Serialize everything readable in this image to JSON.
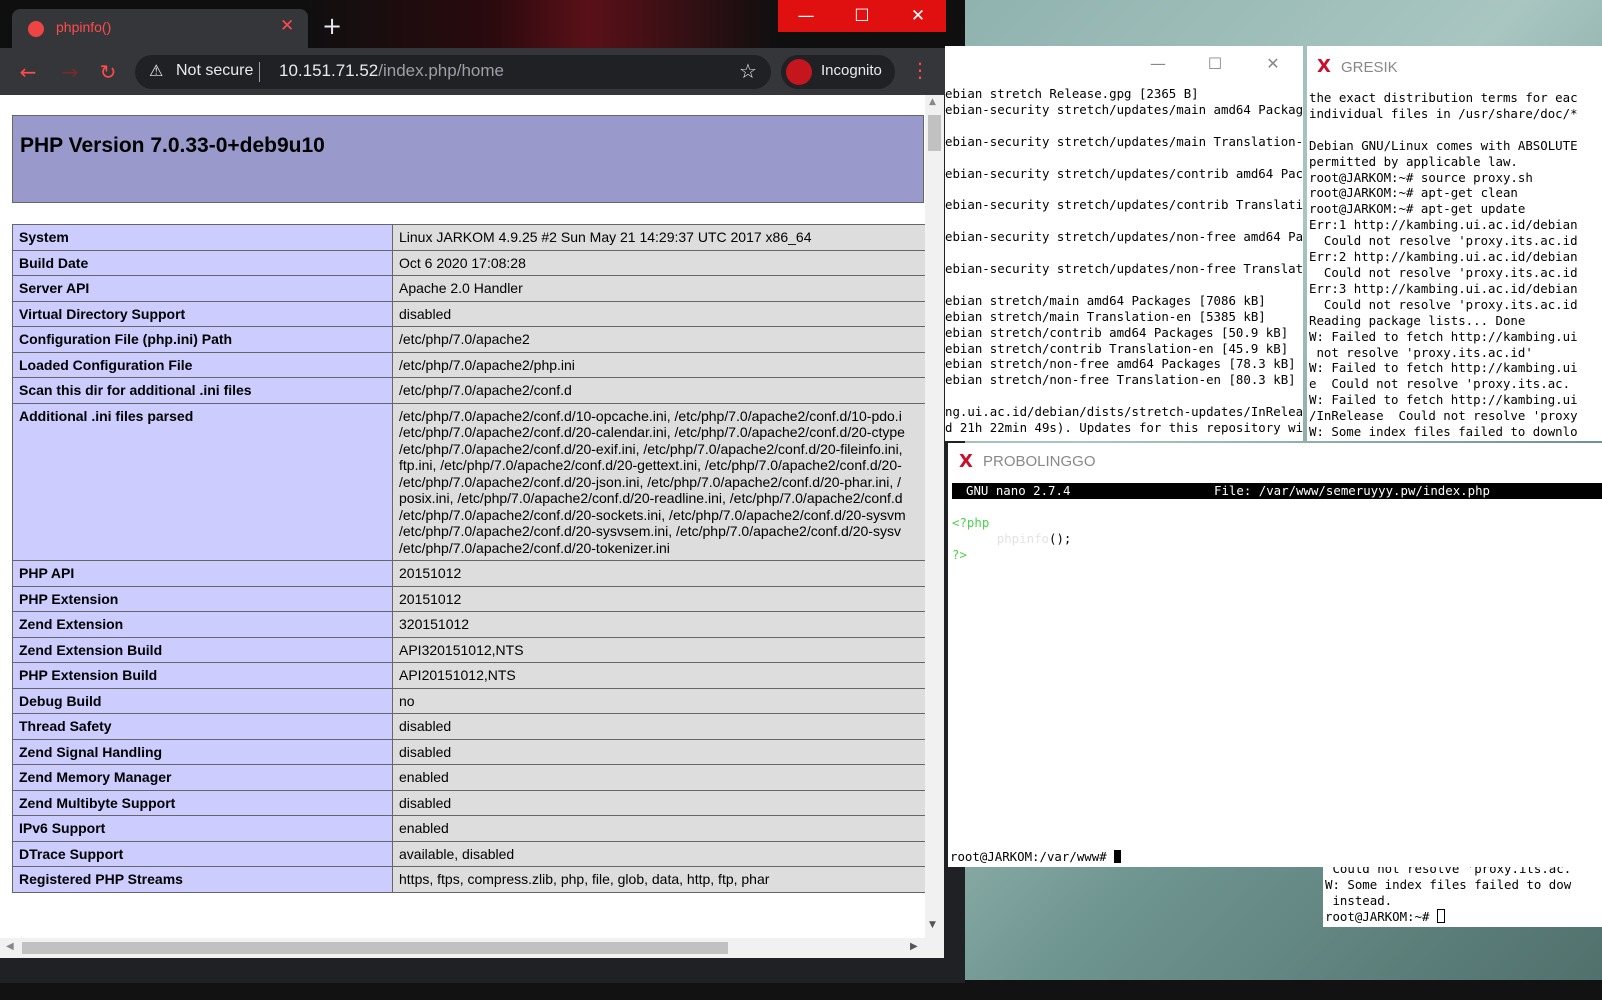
{
  "browser": {
    "tab_title": "phpinfo()",
    "tab_close": "✕",
    "new_tab": "+",
    "window_min": "—",
    "window_max": "☐",
    "window_close": "✕",
    "back": "←",
    "forward": "→",
    "reload": "↻",
    "security_label": "Not secure",
    "url_host": "10.151.71.52",
    "url_path": "/index.php/home",
    "profile_label": "Incognito",
    "accent_color": "#e01010"
  },
  "phpinfo": {
    "title": "PHP Version 7.0.33-0+deb9u10",
    "rows": [
      {
        "label": "System",
        "value": "Linux JARKOM 4.9.25 #2 Sun May 21 14:29:37 UTC 2017 x86_64"
      },
      {
        "label": "Build Date",
        "value": "Oct 6 2020 17:08:28"
      },
      {
        "label": "Server API",
        "value": "Apache 2.0 Handler"
      },
      {
        "label": "Virtual Directory Support",
        "value": "disabled"
      },
      {
        "label": "Configuration File (php.ini) Path",
        "value": "/etc/php/7.0/apache2"
      },
      {
        "label": "Loaded Configuration File",
        "value": "/etc/php/7.0/apache2/php.ini"
      },
      {
        "label": "Scan this dir for additional .ini files",
        "value": "/etc/php/7.0/apache2/conf.d"
      },
      {
        "label": "Additional .ini files parsed",
        "value": "/etc/php/7.0/apache2/conf.d/10-opcache.ini, /etc/php/7.0/apache2/conf.d/10-pdo.i\n/etc/php/7.0/apache2/conf.d/20-calendar.ini, /etc/php/7.0/apache2/conf.d/20-ctype\n/etc/php/7.0/apache2/conf.d/20-exif.ini, /etc/php/7.0/apache2/conf.d/20-fileinfo.ini,\nftp.ini, /etc/php/7.0/apache2/conf.d/20-gettext.ini, /etc/php/7.0/apache2/conf.d/20-\n/etc/php/7.0/apache2/conf.d/20-json.ini, /etc/php/7.0/apache2/conf.d/20-phar.ini, /\nposix.ini, /etc/php/7.0/apache2/conf.d/20-readline.ini, /etc/php/7.0/apache2/conf.d\n/etc/php/7.0/apache2/conf.d/20-sockets.ini, /etc/php/7.0/apache2/conf.d/20-sysvm\n/etc/php/7.0/apache2/conf.d/20-sysvsem.ini, /etc/php/7.0/apache2/conf.d/20-sysv\n/etc/php/7.0/apache2/conf.d/20-tokenizer.ini"
      },
      {
        "label": "PHP API",
        "value": "20151012"
      },
      {
        "label": "PHP Extension",
        "value": "20151012"
      },
      {
        "label": "Zend Extension",
        "value": "320151012"
      },
      {
        "label": "Zend Extension Build",
        "value": "API320151012,NTS"
      },
      {
        "label": "PHP Extension Build",
        "value": "API20151012,NTS"
      },
      {
        "label": "Debug Build",
        "value": "no"
      },
      {
        "label": "Thread Safety",
        "value": "disabled"
      },
      {
        "label": "Zend Signal Handling",
        "value": "disabled"
      },
      {
        "label": "Zend Memory Manager",
        "value": "enabled"
      },
      {
        "label": "Zend Multibyte Support",
        "value": "disabled"
      },
      {
        "label": "IPv6 Support",
        "value": "enabled"
      },
      {
        "label": "DTrace Support",
        "value": "available, disabled"
      },
      {
        "label": "Registered PHP Streams",
        "value": "https, ftps, compress.zlib, php, file, glob, data, http, ftp, phar"
      }
    ]
  },
  "terminal_a": {
    "min": "—",
    "max": "☐",
    "close": "✕",
    "text": "ebian stretch Release.gpg [2365 B]\nebian-security stretch/updates/main amd64 Package\n\nebian-security stretch/updates/main Translation-e\n\nebian-security stretch/updates/contrib amd64 Pack\n\nebian-security stretch/updates/contrib Translatio\n\nebian-security stretch/updates/non-free amd64 Pa\n\nebian-security stretch/updates/non-free Translat\n\nebian stretch/main amd64 Packages [7086 kB]\nebian stretch/main Translation-en [5385 kB]\nebian stretch/contrib amd64 Packages [50.9 kB]\nebian stretch/contrib Translation-en [45.9 kB]\nebian stretch/non-free amd64 Packages [78.3 kB]\nebian stretch/non-free Translation-en [80.3 kB]\n\nng.ui.ac.id/debian/dists/stretch-updates/InRelea\nd 21h 22min 49s). Updates for this repository wi"
  },
  "terminal_b": {
    "title": "GRESIK",
    "text": "the exact distribution terms for eac\nindividual files in /usr/share/doc/*\n\nDebian GNU/Linux comes with ABSOLUTE\npermitted by applicable law.\nroot@JARKOM:~# source proxy.sh\nroot@JARKOM:~# apt-get clean\nroot@JARKOM:~# apt-get update\nErr:1 http://kambing.ui.ac.id/debian\n  Could not resolve 'proxy.its.ac.id\nErr:2 http://kambing.ui.ac.id/debian\n  Could not resolve 'proxy.its.ac.id\nErr:3 http://kambing.ui.ac.id/debian\n  Could not resolve 'proxy.its.ac.id\nReading package lists... Done\nW: Failed to fetch http://kambing.ui\n not resolve 'proxy.its.ac.id'\nW: Failed to fetch http://kambing.ui\ne  Could not resolve 'proxy.its.ac.\nW: Failed to fetch http://kambing.ui\n/InRelease  Could not resolve 'proxy\nW: Some index files failed to downlo"
  },
  "terminal_c": {
    "title": "PROBOLINGGO",
    "nano_version": "GNU nano 2.7.4",
    "nano_file": "File: /var/www/semeruyyy.pw/index.php",
    "code_open": "<?php",
    "code_fn": "phpinfo",
    "code_call": "();",
    "code_close": "?>",
    "prompt": "root@JARKOM:/var/www# "
  },
  "terminal_d": {
    "text": " Could not resolve 'proxy.its.ac.\nW: Some index files failed to dow\n instead.\nroot@JARKOM:~# "
  }
}
